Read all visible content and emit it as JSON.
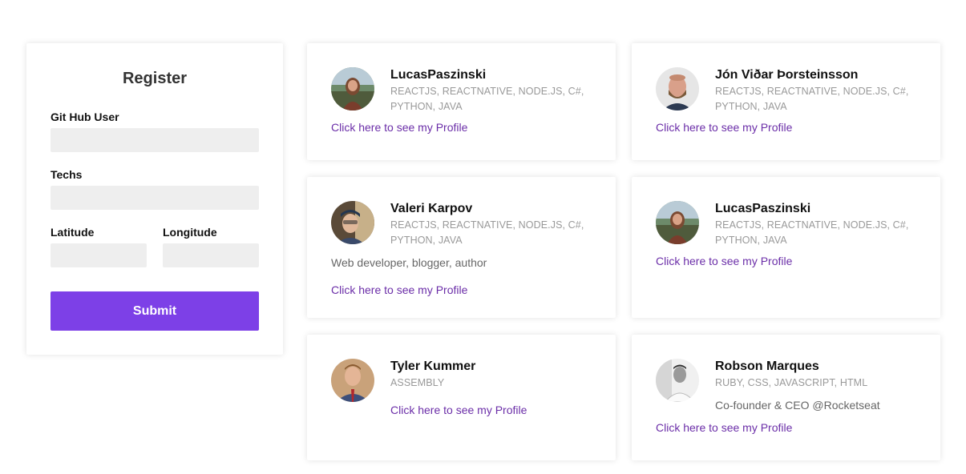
{
  "register": {
    "title": "Register",
    "github_label": "Git Hub User",
    "techs_label": "Techs",
    "latitude_label": "Latitude",
    "longitude_label": "Longitude",
    "github_value": "",
    "techs_value": "",
    "latitude_value": "",
    "longitude_value": "",
    "submit_label": "Submit"
  },
  "colors": {
    "accent": "#7d40e7",
    "link": "#6b2ea8",
    "input_bg": "#eeeeee"
  },
  "devs": [
    {
      "name": "LucasPaszinski",
      "techs": "REACTJS, REACTNATIVE, NODE.JS, C#, PYTHON, JAVA",
      "bio": "",
      "link": "Click here to see my Profile"
    },
    {
      "name": "Jón Viðar Þorsteinsson",
      "techs": "REACTJS, REACTNATIVE, NODE.JS, C#, PYTHON, JAVA",
      "bio": "",
      "link": "Click here to see my Profile"
    },
    {
      "name": "Valeri Karpov",
      "techs": "REACTJS, REACTNATIVE, NODE.JS, C#, PYTHON, JAVA",
      "bio": "Web developer, blogger, author",
      "link": "Click here to see my Profile"
    },
    {
      "name": "LucasPaszinski",
      "techs": "REACTJS, REACTNATIVE, NODE.JS, C#, PYTHON, JAVA",
      "bio": "",
      "link": "Click here to see my Profile"
    },
    {
      "name": "Tyler Kummer",
      "techs": "ASSEMBLY",
      "bio": "",
      "link": "Click here to see my Profile"
    },
    {
      "name": "Robson Marques",
      "techs": "RUBY, CSS, JAVASCRIPT, HTML",
      "bio": "Co-founder & CEO @Rocketseat",
      "link": "Click here to see my Profile"
    }
  ]
}
